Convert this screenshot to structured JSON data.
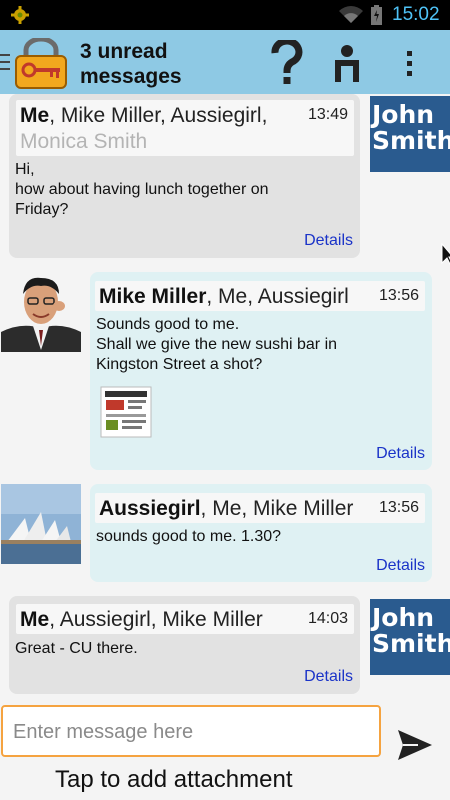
{
  "status_bar": {
    "time": "15:02",
    "icons": [
      "gear-icon",
      "wifi-icon",
      "battery-icon"
    ]
  },
  "action_bar": {
    "title": "3 unread messages",
    "icons": [
      "menu-icon",
      "lock-key-icon",
      "help-icon",
      "contact-icon",
      "overflow-icon"
    ]
  },
  "messages": [
    {
      "sender": "Me",
      "recipients": ", Mike Miller, Aussiegirl,",
      "faded_recipient": "Monica Smith",
      "time": "13:49",
      "line1": "Hi,",
      "line2": "how about having lunch together on",
      "line3": "Friday?",
      "details": "Details",
      "avatar_line1": "John",
      "avatar_line2": "Smith"
    },
    {
      "sender": "Mike Miller",
      "recipients": ", Me, Aussiegirl",
      "time": "13:56",
      "line1": "Sounds good to me.",
      "line2": "Shall we give the new sushi bar in",
      "line3": "Kingston Street a shot?",
      "details": "Details"
    },
    {
      "sender": "Aussiegirl",
      "recipients": ", Me, Mike Miller",
      "time": "13:56",
      "line1": "sounds good to me. 1.30?",
      "details": "Details"
    },
    {
      "sender": "Me",
      "recipients": ", Aussiegirl, Mike Miller",
      "time": "14:03",
      "line1": "Great - CU there.",
      "details": "Details",
      "avatar_line1": "John",
      "avatar_line2": "Smith"
    }
  ],
  "composer": {
    "placeholder": "Enter message here",
    "attach_label": "Tap to add attachment"
  },
  "colors": {
    "action_bar": "#8ec9e4",
    "my_bubble": "#e2e2e2",
    "their_bubble": "#dff1f3",
    "link": "#1a33c8",
    "input_border": "#f5a340"
  }
}
